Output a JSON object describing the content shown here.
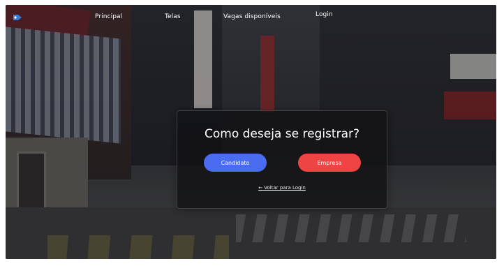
{
  "nav": {
    "logo_icon": "tag-logo-icon",
    "items": [
      {
        "label": "Principal"
      },
      {
        "label": "Telas"
      },
      {
        "label": "Vagas disponíveis"
      },
      {
        "label": "Login"
      }
    ]
  },
  "modal": {
    "title": "Como deseja se registrar?",
    "candidate_label": "Candidato",
    "company_label": "Empresa",
    "back_link": "← Voltar para Login"
  },
  "colors": {
    "candidate_button": "#4a6cf0",
    "company_button": "#ee4444",
    "logo": "#3a7bd5"
  }
}
